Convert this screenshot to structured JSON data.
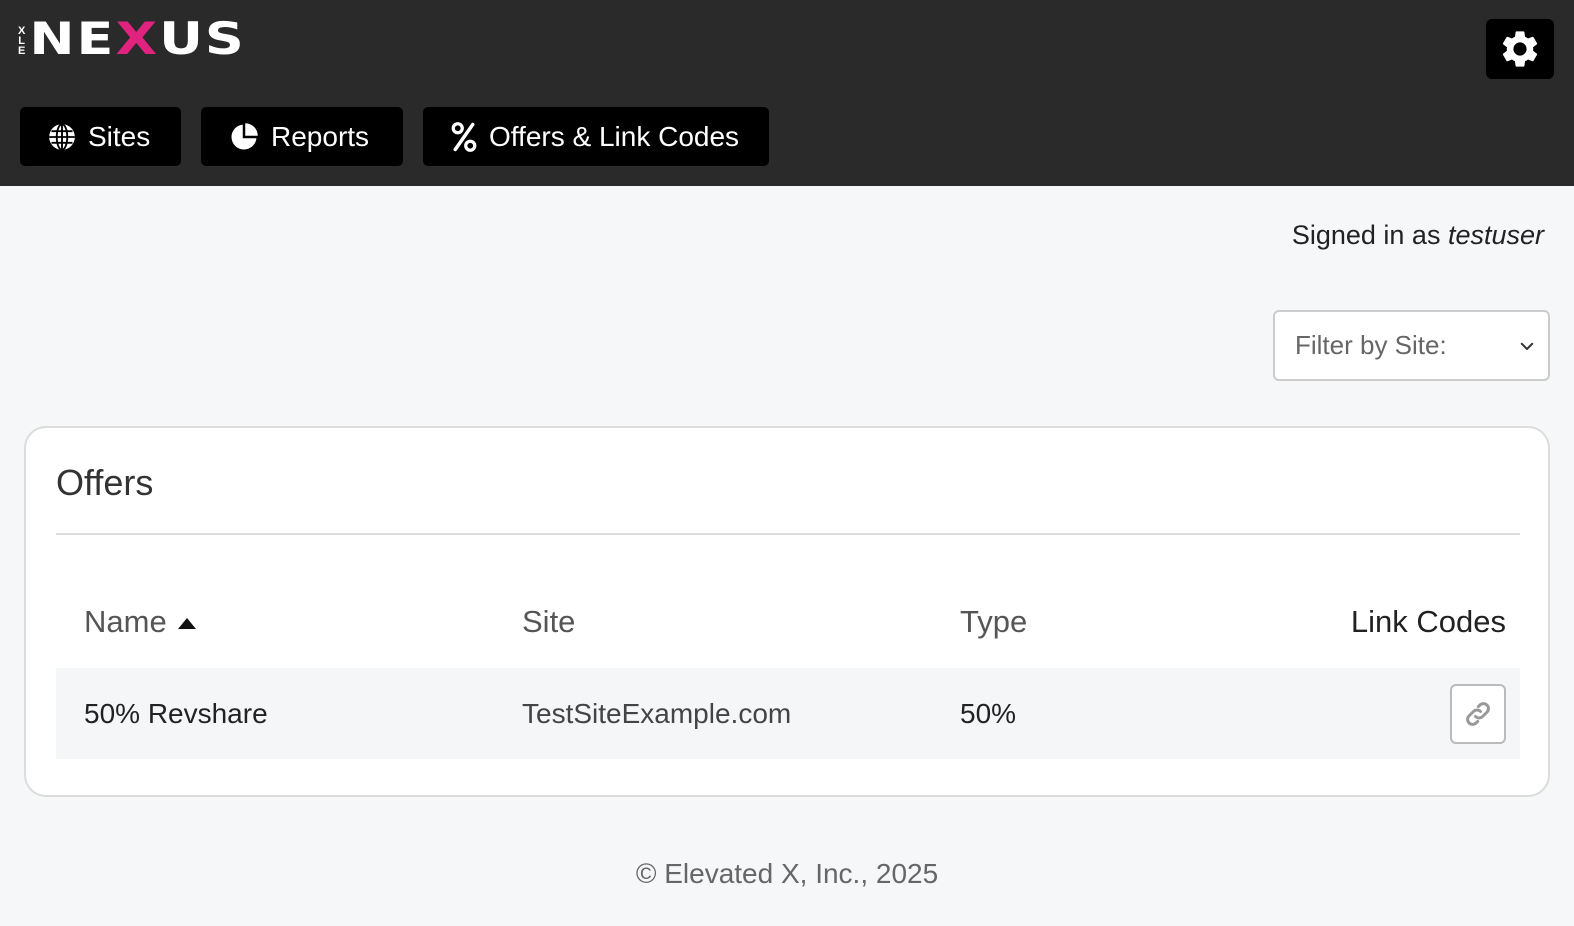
{
  "brand": {
    "logo_prefix": "ELX",
    "logo_word_start": "NE",
    "logo_word_x": "X",
    "logo_word_end": "US",
    "accent_color": "#e0237f"
  },
  "header": {
    "settings_icon": "gear-icon",
    "nav": [
      {
        "label": "Sites",
        "icon": "globe-icon"
      },
      {
        "label": "Reports",
        "icon": "pie-chart-icon"
      },
      {
        "label": "Offers & Link Codes",
        "icon": "percent-icon"
      }
    ]
  },
  "user": {
    "prefix": "Signed in as ",
    "username": "testuser"
  },
  "filter": {
    "label": "Filter by Site:"
  },
  "offers": {
    "title": "Offers",
    "columns": {
      "name": "Name",
      "site": "Site",
      "type": "Type",
      "link_codes": "Link Codes"
    },
    "rows": [
      {
        "name": "50% Revshare",
        "site": "TestSiteExample.com",
        "type": "50%",
        "action_icon": "link-icon"
      }
    ]
  },
  "footer": {
    "copyright": "© Elevated X, Inc., 2025"
  }
}
